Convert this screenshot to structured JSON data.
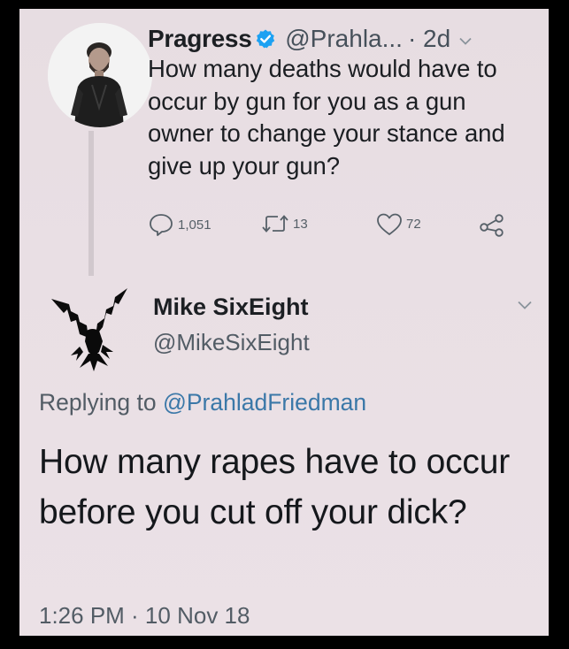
{
  "tweet": {
    "author_name": "Pragress",
    "author_handle": "@Prahla...",
    "age": "· 2d",
    "text": "How many deaths would have to occur by gun for you as a gun owner to change your stance and give up your gun?",
    "replies": "1,051",
    "retweets": "13",
    "likes": "72"
  },
  "reply": {
    "author_name": "Mike SixEight",
    "author_handle": "@MikeSixEight",
    "replying_prefix": "Replying to ",
    "replying_to": "@PrahladFriedman",
    "text": "How many rapes have to occur before you cut off your dick?",
    "timestamp": "1:26 PM · 10 Nov 18"
  },
  "colors": {
    "background": "#e9dfe4",
    "verified_badge": "#1da1f2",
    "mention_link": "#3b78a8",
    "frame": "#000000"
  },
  "icons": {
    "verified": "verified-badge-icon",
    "reply": "reply-icon",
    "retweet": "retweet-icon",
    "like": "heart-icon",
    "share": "share-icon",
    "menu": "chevron-down-icon"
  }
}
